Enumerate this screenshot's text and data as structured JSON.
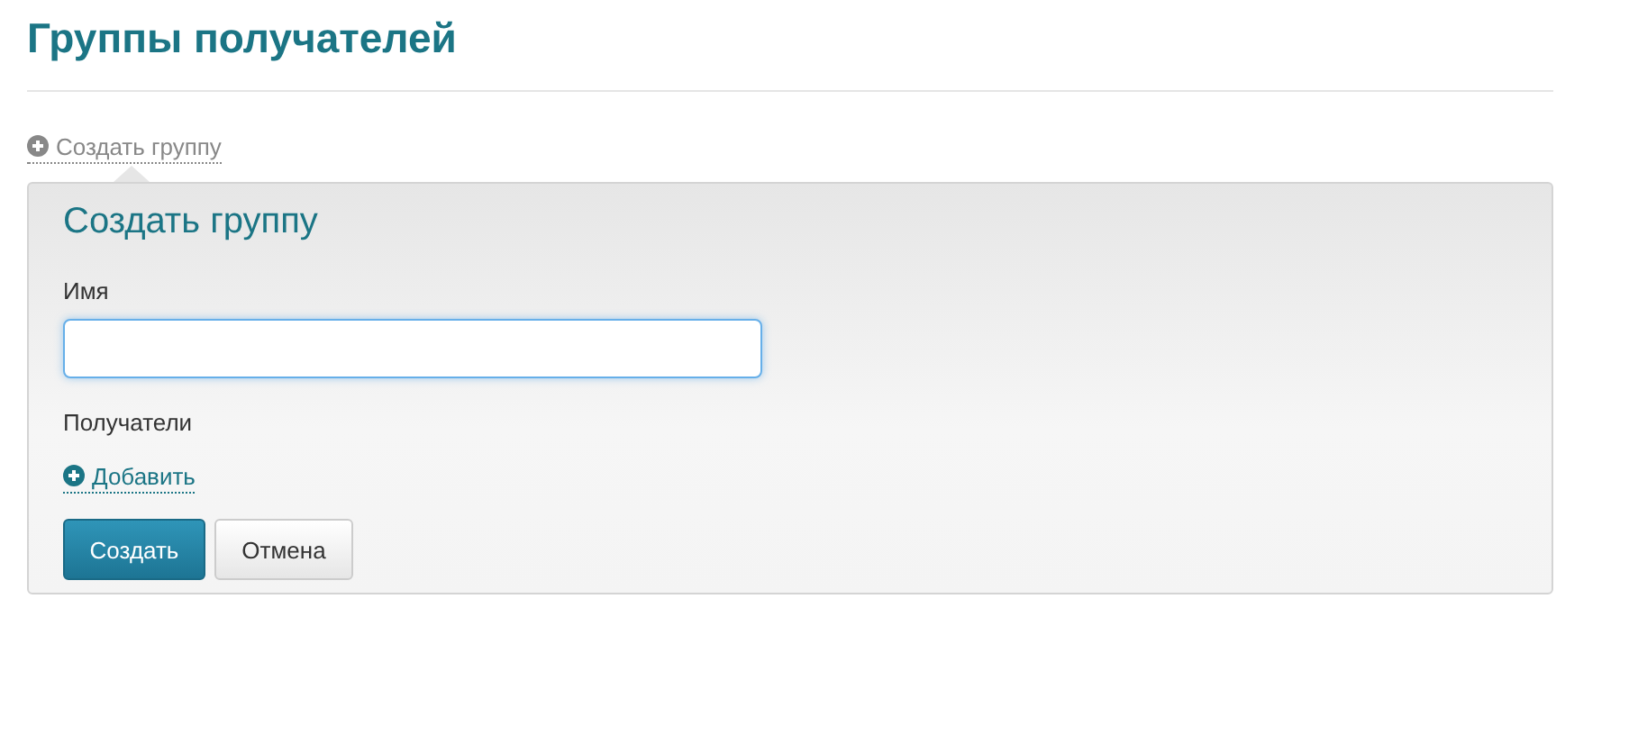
{
  "page": {
    "title": "Группы получателей"
  },
  "toggle_link": {
    "label": "Создать группу"
  },
  "panel": {
    "title": "Создать группу",
    "fields": [
      {
        "kind": "input",
        "label": "Имя",
        "focused": true
      },
      {
        "kind": "list",
        "label": "Получатели",
        "add_link": "Добавить"
      }
    ],
    "buttons": [
      {
        "label": "Создать",
        "kind": "primary"
      },
      {
        "label": "Отмена",
        "kind": "default"
      }
    ]
  }
}
